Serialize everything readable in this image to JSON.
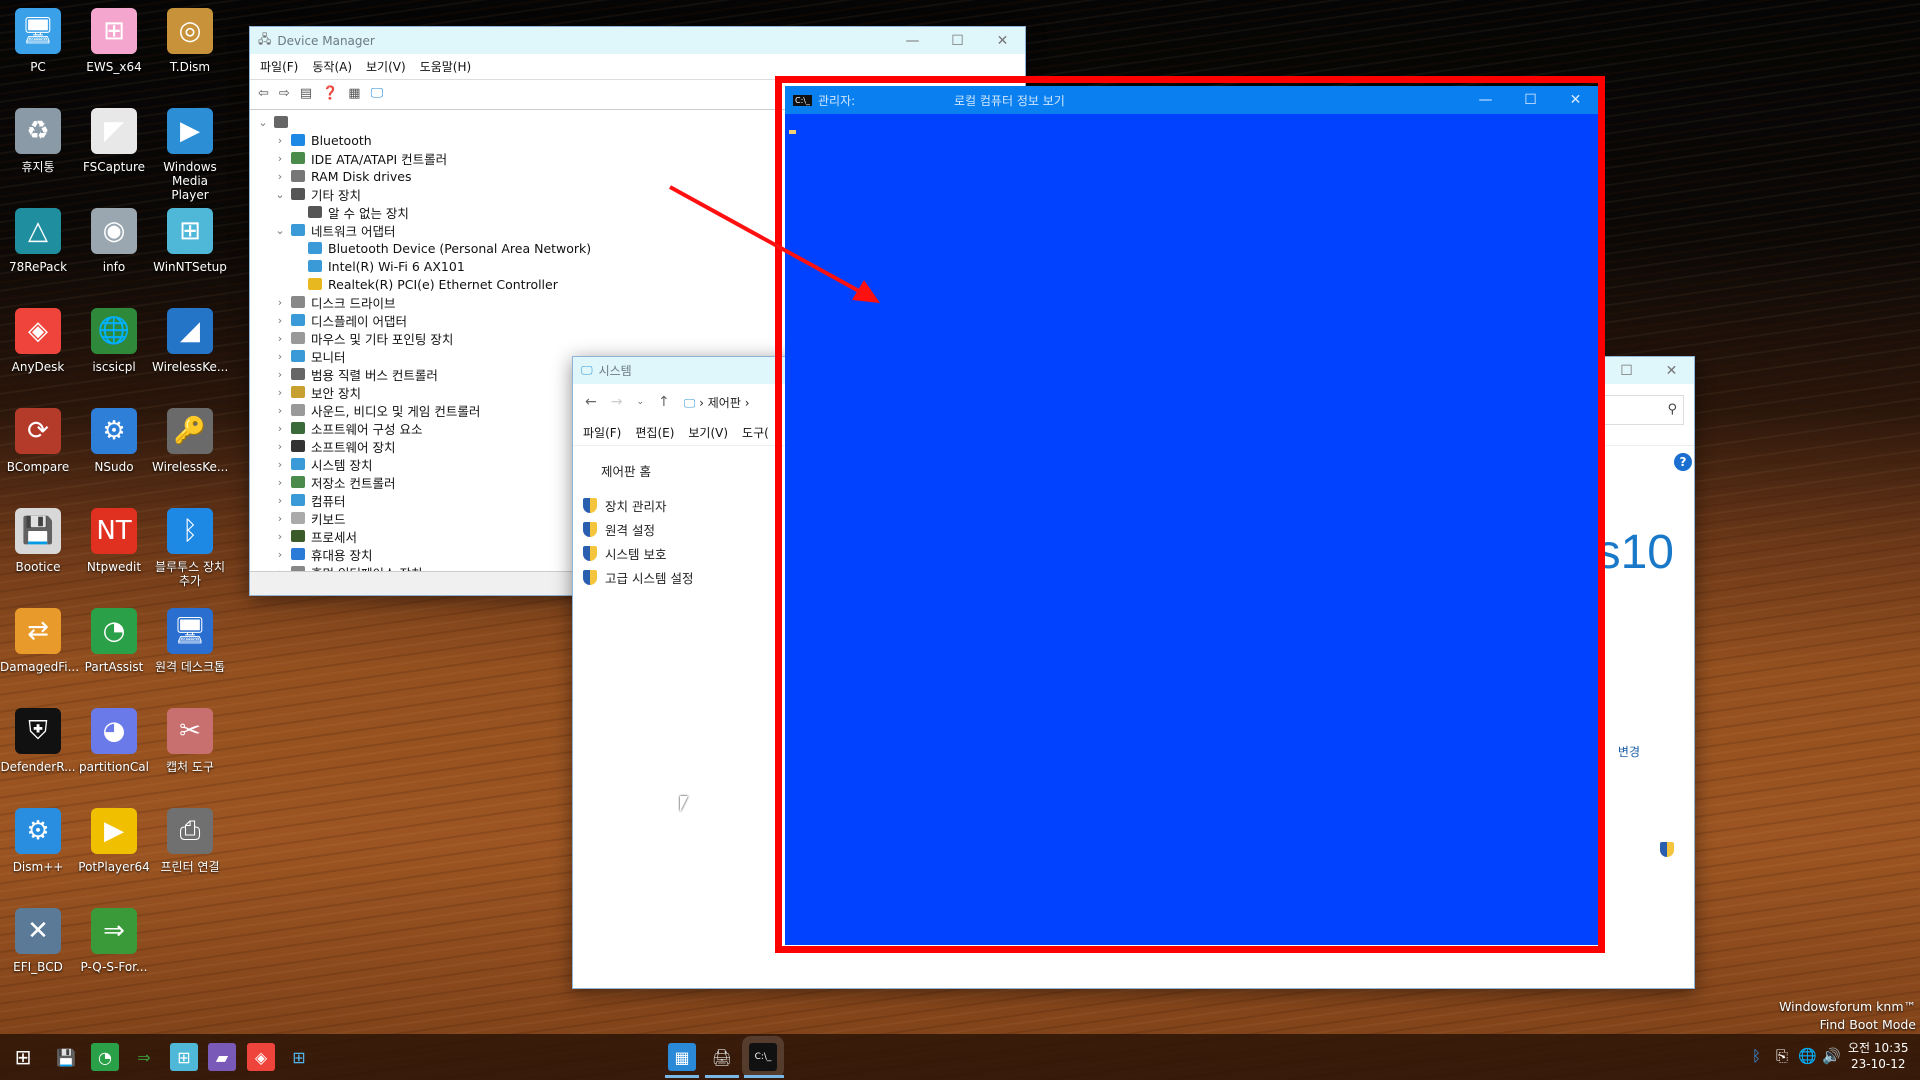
{
  "desktop": {
    "icons": [
      {
        "label": "PC",
        "color": "#3aa0e8",
        "glyph": "🖥"
      },
      {
        "label": "EWS_x64",
        "color": "#f5a6cf",
        "glyph": "⊞"
      },
      {
        "label": "T.Dism",
        "color": "#c8923a",
        "glyph": "◎"
      },
      {
        "label": "휴지통",
        "color": "#8a9aa6",
        "glyph": "♻"
      },
      {
        "label": "FSCapture",
        "color": "#e8e8e8",
        "glyph": "◤"
      },
      {
        "label": "Windows Media Player",
        "color": "#2c8fd6",
        "glyph": "▶"
      },
      {
        "label": "78RePack",
        "color": "#1f8fa0",
        "glyph": "△"
      },
      {
        "label": "info",
        "color": "#9aa7b0",
        "glyph": "◉"
      },
      {
        "label": "WinNTSetup",
        "color": "#4fb8d8",
        "glyph": "⊞"
      },
      {
        "label": "AnyDesk",
        "color": "#ef443b",
        "glyph": "◈"
      },
      {
        "label": "iscsicpl",
        "color": "#2e8a3a",
        "glyph": "🌐"
      },
      {
        "label": "WirelessKe...",
        "color": "#2474c8",
        "glyph": "◢"
      },
      {
        "label": "BCompare",
        "color": "#b43a2a",
        "glyph": "⟳"
      },
      {
        "label": "NSudo",
        "color": "#2e7fd8",
        "glyph": "⚙"
      },
      {
        "label": "WirelessKe...",
        "color": "#6a6a6a",
        "glyph": "🔑"
      },
      {
        "label": "Bootice",
        "color": "#d8d8d8",
        "glyph": "💾"
      },
      {
        "label": "Ntpwedit",
        "color": "#e03020",
        "glyph": "NT"
      },
      {
        "label": "블루투스 장치 추가",
        "color": "#1e88e5",
        "glyph": "ᛒ"
      },
      {
        "label": "DamagedFi...",
        "color": "#e89a2a",
        "glyph": "⇄"
      },
      {
        "label": "PartAssist",
        "color": "#2aa048",
        "glyph": "◔"
      },
      {
        "label": "원격 데스크톱",
        "color": "#2a6fd0",
        "glyph": "🖥"
      },
      {
        "label": "DefenderR...",
        "color": "#111111",
        "glyph": "⛨"
      },
      {
        "label": "partitionCal",
        "color": "#6a7ae8",
        "glyph": "◕"
      },
      {
        "label": "캡처 도구",
        "color": "#c87070",
        "glyph": "✂"
      },
      {
        "label": "Dism++",
        "color": "#2a8ee0",
        "glyph": "⚙"
      },
      {
        "label": "PotPlayer64",
        "color": "#f0c000",
        "glyph": "▶"
      },
      {
        "label": "프린터 연결",
        "color": "#707070",
        "glyph": "⎙"
      },
      {
        "label": "EFI_BCD",
        "color": "#5a7a98",
        "glyph": "✕"
      },
      {
        "label": "P-Q-S-For...",
        "color": "#3a9a3a",
        "glyph": "⇒"
      }
    ]
  },
  "device_manager": {
    "title": "Device Manager",
    "menu": [
      "파일(F)",
      "동작(A)",
      "보기(V)",
      "도움말(H)"
    ],
    "tree": [
      {
        "label": "",
        "level": 0,
        "state": "expanded",
        "color": "#666"
      },
      {
        "label": "Bluetooth",
        "level": 1,
        "state": "collapsed",
        "color": "#1e88e5"
      },
      {
        "label": "IDE ATA/ATAPI 컨트롤러",
        "level": 1,
        "state": "collapsed",
        "color": "#4a8a4a"
      },
      {
        "label": "RAM Disk drives",
        "level": 1,
        "state": "collapsed",
        "color": "#777"
      },
      {
        "label": "기타 장치",
        "level": 1,
        "state": "expanded",
        "color": "#555"
      },
      {
        "label": "알 수 없는 장치",
        "level": 2,
        "state": "none",
        "color": "#555"
      },
      {
        "label": "네트워크 어댑터",
        "level": 1,
        "state": "expanded",
        "color": "#3a9ad8"
      },
      {
        "label": "Bluetooth Device (Personal Area Network)",
        "level": 2,
        "state": "none",
        "color": "#3a9ad8"
      },
      {
        "label": "Intel(R) Wi-Fi 6 AX101",
        "level": 2,
        "state": "none",
        "color": "#3a9ad8"
      },
      {
        "label": "Realtek(R) PCI(e) Ethernet Controller",
        "level": 2,
        "state": "none",
        "color": "#e8b820",
        "warning": true
      },
      {
        "label": "디스크 드라이브",
        "level": 1,
        "state": "collapsed",
        "color": "#888"
      },
      {
        "label": "디스플레이 어댑터",
        "level": 1,
        "state": "collapsed",
        "color": "#3a9ad8"
      },
      {
        "label": "마우스 및 기타 포인팅 장치",
        "level": 1,
        "state": "collapsed",
        "color": "#999"
      },
      {
        "label": "모니터",
        "level": 1,
        "state": "collapsed",
        "color": "#3a9ad8"
      },
      {
        "label": "범용 직렬 버스 컨트롤러",
        "level": 1,
        "state": "collapsed",
        "color": "#666"
      },
      {
        "label": "보안 장치",
        "level": 1,
        "state": "collapsed",
        "color": "#c8a030"
      },
      {
        "label": "사운드, 비디오 및 게임 컨트롤러",
        "level": 1,
        "state": "collapsed",
        "color": "#999"
      },
      {
        "label": "소프트웨어 구성 요소",
        "level": 1,
        "state": "collapsed",
        "color": "#3a6a3a"
      },
      {
        "label": "소프트웨어 장치",
        "level": 1,
        "state": "collapsed",
        "color": "#333"
      },
      {
        "label": "시스템 장치",
        "level": 1,
        "state": "collapsed",
        "color": "#3a9ad8"
      },
      {
        "label": "저장소 컨트롤러",
        "level": 1,
        "state": "collapsed",
        "color": "#4a8a4a"
      },
      {
        "label": "컴퓨터",
        "level": 1,
        "state": "collapsed",
        "color": "#3a9ad8"
      },
      {
        "label": "키보드",
        "level": 1,
        "state": "collapsed",
        "color": "#aaa"
      },
      {
        "label": "프로세서",
        "level": 1,
        "state": "collapsed",
        "color": "#3a5a2a"
      },
      {
        "label": "휴대용 장치",
        "level": 1,
        "state": "collapsed",
        "color": "#2a7ad8"
      },
      {
        "label": "휴먼 인터페이스 장치",
        "level": 1,
        "state": "collapsed",
        "color": "#888"
      }
    ]
  },
  "system_window": {
    "title": "시스템",
    "breadcrumb": [
      "제어판"
    ],
    "menu": [
      "파일(F)",
      "편집(E)",
      "보기(V)",
      "도구("
    ],
    "home_link": "제어판 홈",
    "links": [
      "장치 관리자",
      "원격 설정",
      "시스템 보호",
      "고급 시스템 설정"
    ],
    "logo_text_fragment": "s10",
    "change_fragment": "변경"
  },
  "cmd_window": {
    "title_prefix": "관리자:",
    "title": "로컬 컴퓨터 정보 보기",
    "bg_color": "#0042ff",
    "titlebar_color": "#0a80f0"
  },
  "annotation": {
    "color": "#ff0000"
  },
  "taskbar": {
    "pinned": [
      "start",
      "bootice",
      "partassist",
      "pqs",
      "winntsetup",
      "folder",
      "anydesk",
      "winntsetup2"
    ],
    "running": [
      "system",
      "device-manager",
      "cmd"
    ]
  },
  "watermark": [
    "Windowsforum knm™",
    "Find Boot Mode"
  ],
  "clock": {
    "time": "오전 10:35",
    "date": "23-10-12"
  }
}
